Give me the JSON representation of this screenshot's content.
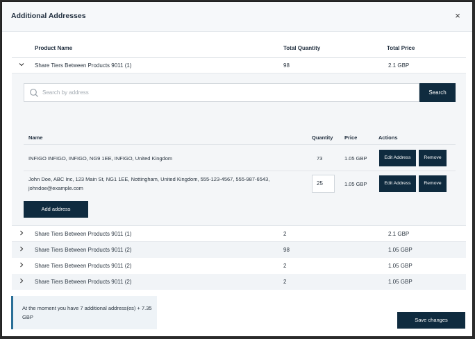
{
  "modal": {
    "title": "Additional Addresses",
    "close_symbol": "×"
  },
  "table": {
    "headers": {
      "product": "Product Name",
      "quantity": "Total Quantity",
      "price": "Total Price"
    },
    "expanded_row": {
      "product": "Share Tiers Between Products 9011 (1)",
      "quantity": "98",
      "price": "2.1 GBP"
    },
    "rows": [
      {
        "product": "Share Tiers Between Products 9011 (1)",
        "quantity": "2",
        "price": "2.1 GBP"
      },
      {
        "product": "Share Tiers Between Products 9011 (2)",
        "quantity": "98",
        "price": "1.05 GBP"
      },
      {
        "product": "Share Tiers Between Products 9011 (2)",
        "quantity": "2",
        "price": "1.05 GBP"
      },
      {
        "product": "Share Tiers Between Products 9011 (2)",
        "quantity": "2",
        "price": "1.05 GBP"
      }
    ]
  },
  "panel": {
    "search": {
      "placeholder": "Search by address",
      "value": "",
      "button_label": "Search"
    },
    "headers": {
      "name": "Name",
      "quantity": "Quantity",
      "price": "Price",
      "actions": "Actions"
    },
    "addresses": [
      {
        "name": "INFIGO INFIGO, INFIGO, NG9 1EE, INFIGO, United Kingdom",
        "quantity": "73",
        "price": "1.05 GBP"
      },
      {
        "name": "John Doe, ABC Inc, 123 Main St, NG1 1EE, Nottingham, United Kingdom, 555-123-4567, 555-987-6543, johndoe@example.com",
        "quantity": "25",
        "price": "1.05 GBP"
      }
    ],
    "edit_label": "Edit Address",
    "remove_label": "Remove",
    "add_label": "Add address"
  },
  "footer": {
    "info_text": "At the moment you have 7 additional address(es) + 7.35 GBP",
    "save_label": "Save changes"
  },
  "colors": {
    "primary_button": "#0f2b3f",
    "info_accent": "#2a6f97"
  }
}
